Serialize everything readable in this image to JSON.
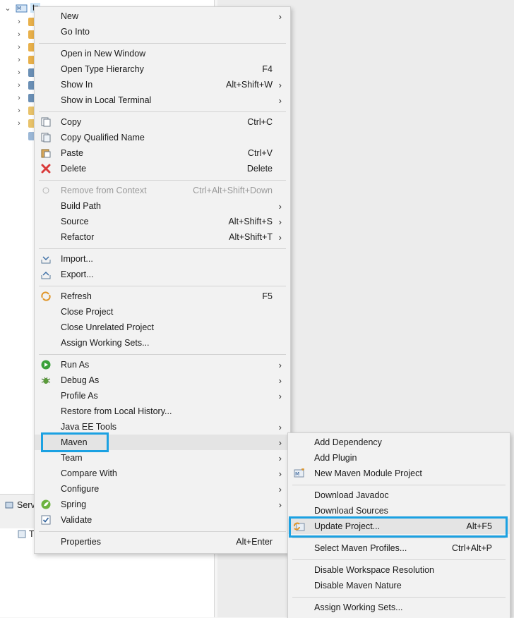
{
  "explorer": {
    "project_label": "tr",
    "servers_tab_label": "Serv",
    "servers_row_label": "T"
  },
  "context_menu": {
    "items": [
      {
        "label": "New",
        "accel": "",
        "submenu": true
      },
      {
        "label": "Go Into",
        "accel": "",
        "submenu": false
      },
      {
        "label": "Open in New Window",
        "accel": "",
        "submenu": false
      },
      {
        "label": "Open Type Hierarchy",
        "accel": "F4",
        "submenu": false
      },
      {
        "label": "Show In",
        "accel": "Alt+Shift+W",
        "submenu": true
      },
      {
        "label": "Show in Local Terminal",
        "accel": "",
        "submenu": true
      },
      {
        "label": "Copy",
        "accel": "Ctrl+C",
        "icon": "copy-icon"
      },
      {
        "label": "Copy Qualified Name",
        "accel": "",
        "icon": "copy-qualified-icon"
      },
      {
        "label": "Paste",
        "accel": "Ctrl+V",
        "icon": "paste-icon"
      },
      {
        "label": "Delete",
        "accel": "Delete",
        "icon": "delete-icon"
      },
      {
        "label": "Remove from Context",
        "accel": "Ctrl+Alt+Shift+Down",
        "disabled": true,
        "icon": "remove-context-icon"
      },
      {
        "label": "Build Path",
        "accel": "",
        "submenu": true
      },
      {
        "label": "Source",
        "accel": "Alt+Shift+S",
        "submenu": true
      },
      {
        "label": "Refactor",
        "accel": "Alt+Shift+T",
        "submenu": true
      },
      {
        "label": "Import...",
        "accel": "",
        "icon": "import-icon"
      },
      {
        "label": "Export...",
        "accel": "",
        "icon": "export-icon"
      },
      {
        "label": "Refresh",
        "accel": "F5",
        "icon": "refresh-icon"
      },
      {
        "label": "Close Project",
        "accel": ""
      },
      {
        "label": "Close Unrelated Project",
        "accel": ""
      },
      {
        "label": "Assign Working Sets...",
        "accel": ""
      },
      {
        "label": "Run As",
        "accel": "",
        "submenu": true,
        "icon": "run-icon"
      },
      {
        "label": "Debug As",
        "accel": "",
        "submenu": true,
        "icon": "debug-icon"
      },
      {
        "label": "Profile As",
        "accel": "",
        "submenu": true
      },
      {
        "label": "Restore from Local History...",
        "accel": ""
      },
      {
        "label": "Java EE Tools",
        "accel": "",
        "submenu": true
      },
      {
        "label": "Maven",
        "accel": "",
        "submenu": true,
        "highlighted": true
      },
      {
        "label": "Team",
        "accel": "",
        "submenu": true
      },
      {
        "label": "Compare With",
        "accel": "",
        "submenu": true
      },
      {
        "label": "Configure",
        "accel": "",
        "submenu": true
      },
      {
        "label": "Spring",
        "accel": "",
        "submenu": true,
        "icon": "spring-icon"
      },
      {
        "label": "Validate",
        "accel": "",
        "icon": "validate-check-icon"
      },
      {
        "label": "Properties",
        "accel": "Alt+Enter"
      }
    ]
  },
  "maven_submenu": {
    "items": [
      {
        "label": "Add Dependency",
        "accel": ""
      },
      {
        "label": "Add Plugin",
        "accel": ""
      },
      {
        "label": "New Maven Module Project",
        "accel": "",
        "icon": "maven-module-icon"
      },
      {
        "label": "Download Javadoc",
        "accel": ""
      },
      {
        "label": "Download Sources",
        "accel": ""
      },
      {
        "label": "Update Project...",
        "accel": "Alt+F5",
        "icon": "maven-update-icon",
        "highlighted": true
      },
      {
        "label": "Select Maven Profiles...",
        "accel": "Ctrl+Alt+P"
      },
      {
        "label": "Disable Workspace Resolution",
        "accel": ""
      },
      {
        "label": "Disable Maven Nature",
        "accel": ""
      },
      {
        "label": "Assign Working Sets...",
        "accel": ""
      }
    ]
  },
  "colors": {
    "highlight_box": "#1ba1e2",
    "menu_bg": "#f2f2f2",
    "delete_red": "#d93a3a",
    "run_green": "#3aa03a"
  }
}
